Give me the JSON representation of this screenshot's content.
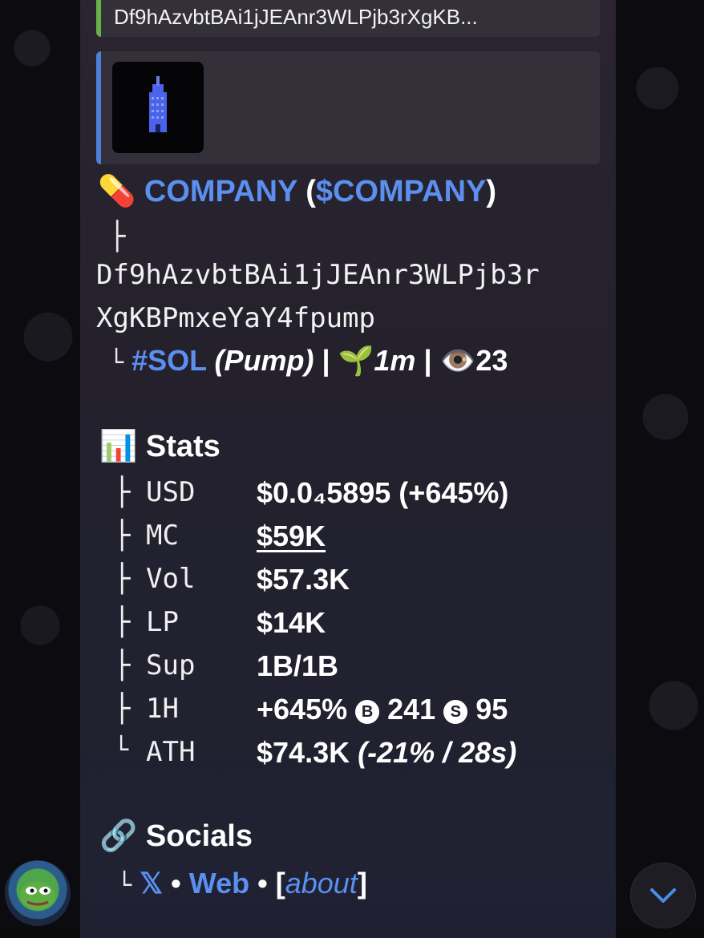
{
  "quoted_message": {
    "address_preview": "Df9hAzvbtBAi1jJEAnr3WLPjb3rXgKB..."
  },
  "token": {
    "pill_emoji": "💊",
    "name": "COMPANY",
    "ticker": "$COMPANY",
    "paren_open": "(",
    "paren_close": ")",
    "address_line1": "Df9hAzvbtBAi1jJEAnr3WLPjb3r",
    "address_line2": "XgKBPmxeYaY4fpump",
    "chain": "#SOL",
    "platform": "(Pump)",
    "separator": "|",
    "age_emoji": "🌱",
    "age": "1m",
    "views_emoji": "👁️",
    "views": "23"
  },
  "tree": {
    "branch": "├",
    "end": "└"
  },
  "stats": {
    "emoji": "📊",
    "title": "Stats",
    "rows": [
      {
        "label": "USD",
        "value": "$0.0₄5895 (+645%)"
      },
      {
        "label": "MC",
        "value": "$59K"
      },
      {
        "label": "Vol",
        "value": "$57.3K"
      },
      {
        "label": "LP",
        "value": "$14K"
      },
      {
        "label": "Sup",
        "value": "1B/1B"
      },
      {
        "label": "1H",
        "value_pct": "+645%",
        "buy_icon": "B",
        "buys": "241",
        "sell_icon": "S",
        "sells": "95"
      },
      {
        "label": "ATH",
        "value": "$74.3K",
        "value_detail": "(-21% / 28s)"
      }
    ]
  },
  "socials": {
    "emoji": "🔗",
    "title": "Socials",
    "x_label": "𝕏",
    "dot": "•",
    "web_label": "Web",
    "about_open": "[",
    "about_label": "about",
    "about_close": "]"
  },
  "icons": {
    "avatar": "pepe-avatar",
    "scroll_down": "chevron-down-icon"
  },
  "colors": {
    "link_blue": "#5b8ff0",
    "quote_bar_green": "#69b04b",
    "quote_bar_blue": "#4f7fd9"
  }
}
